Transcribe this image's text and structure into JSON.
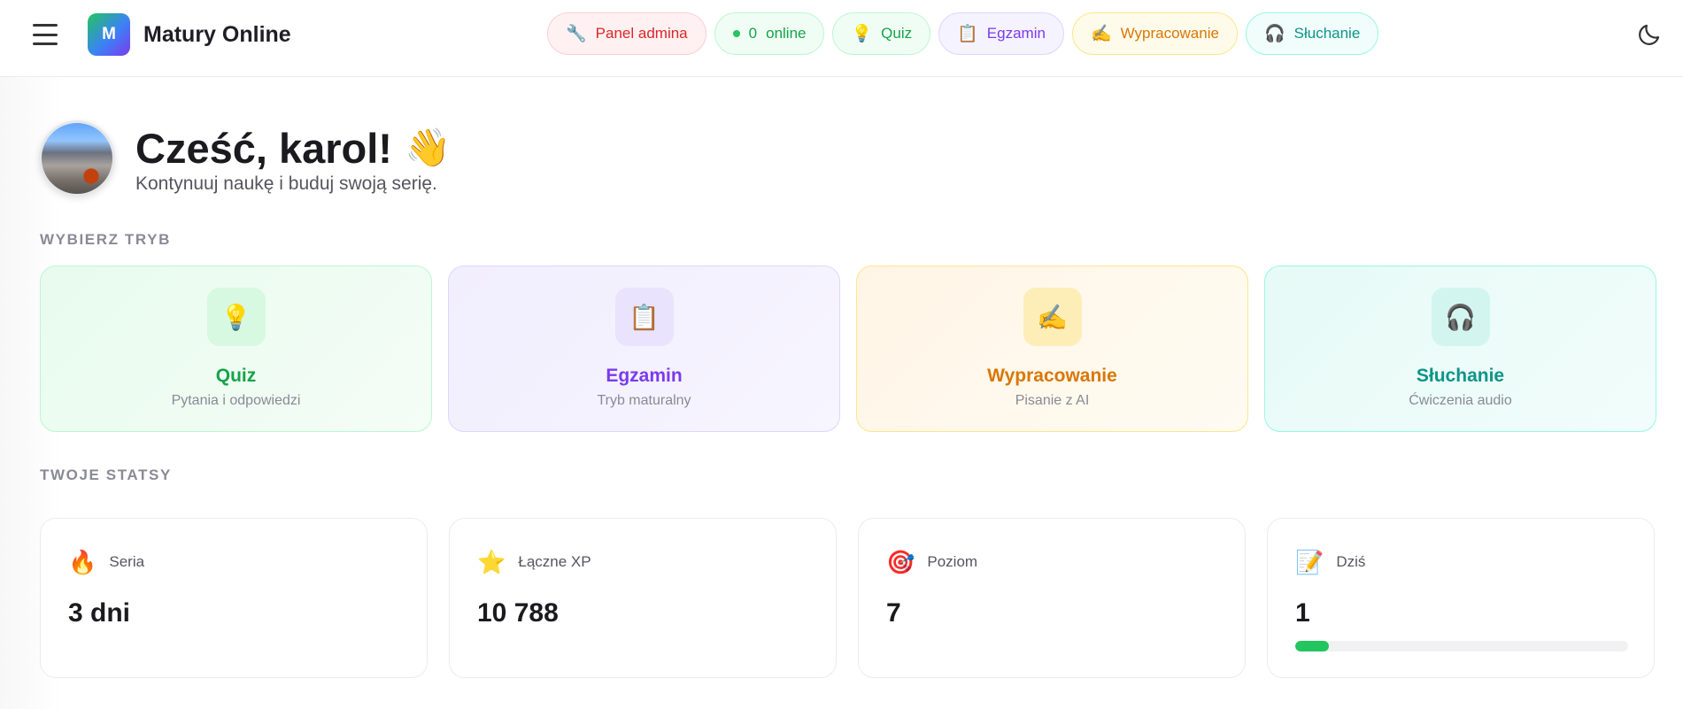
{
  "header": {
    "app_title": "Matury Online",
    "logo_letter": "M",
    "nav": [
      {
        "label": "Panel admina",
        "icon": "wrench-icon",
        "glyph": "🔧"
      },
      {
        "count": "0",
        "label": "online",
        "icon": "status-dot"
      },
      {
        "label": "Quiz",
        "icon": "lightbulb-icon",
        "glyph": "💡"
      },
      {
        "label": "Egzamin",
        "icon": "clipboard-icon",
        "glyph": "📋"
      },
      {
        "label": "Wypracowanie",
        "icon": "writing-hand-icon",
        "glyph": "✍️"
      },
      {
        "label": "Słuchanie",
        "icon": "headphones-icon",
        "glyph": "🎧"
      }
    ],
    "theme_icon": "moon-icon"
  },
  "greeting": {
    "title": "Cześć, karol!",
    "wave": "👋",
    "subtitle": "Kontynuuj naukę i buduj swoją serię."
  },
  "modes_section": {
    "label": "WYBIERZ TRYB",
    "cards": [
      {
        "title": "Quiz",
        "subtitle": "Pytania i odpowiedzi",
        "icon": "lightbulb-icon",
        "glyph": "💡"
      },
      {
        "title": "Egzamin",
        "subtitle": "Tryb maturalny",
        "icon": "clipboard-icon",
        "glyph": "📋"
      },
      {
        "title": "Wypracowanie",
        "subtitle": "Pisanie z AI",
        "icon": "writing-hand-icon",
        "glyph": "✍️"
      },
      {
        "title": "Słuchanie",
        "subtitle": "Ćwiczenia audio",
        "icon": "headphones-icon",
        "glyph": "🎧"
      }
    ]
  },
  "stats_section": {
    "label": "TWOJE STATSY",
    "cards": [
      {
        "label": "Seria",
        "value": "3 dni",
        "icon": "fire-icon",
        "glyph": "🔥"
      },
      {
        "label": "Łączne XP",
        "value": "10 788",
        "icon": "star-icon",
        "glyph": "⭐"
      },
      {
        "label": "Poziom",
        "value": "7",
        "icon": "target-icon",
        "glyph": "🎯"
      },
      {
        "label": "Dziś",
        "value": "1",
        "icon": "memo-icon",
        "glyph": "📝",
        "progress_fraction": 0.1
      }
    ]
  },
  "colors": {
    "accent_green": "#22c55e",
    "quiz": "#16a34a",
    "egzamin": "#7c3aed",
    "wypracowanie": "#d97706",
    "sluchanie": "#0d9488",
    "admin": "#dc2626"
  }
}
